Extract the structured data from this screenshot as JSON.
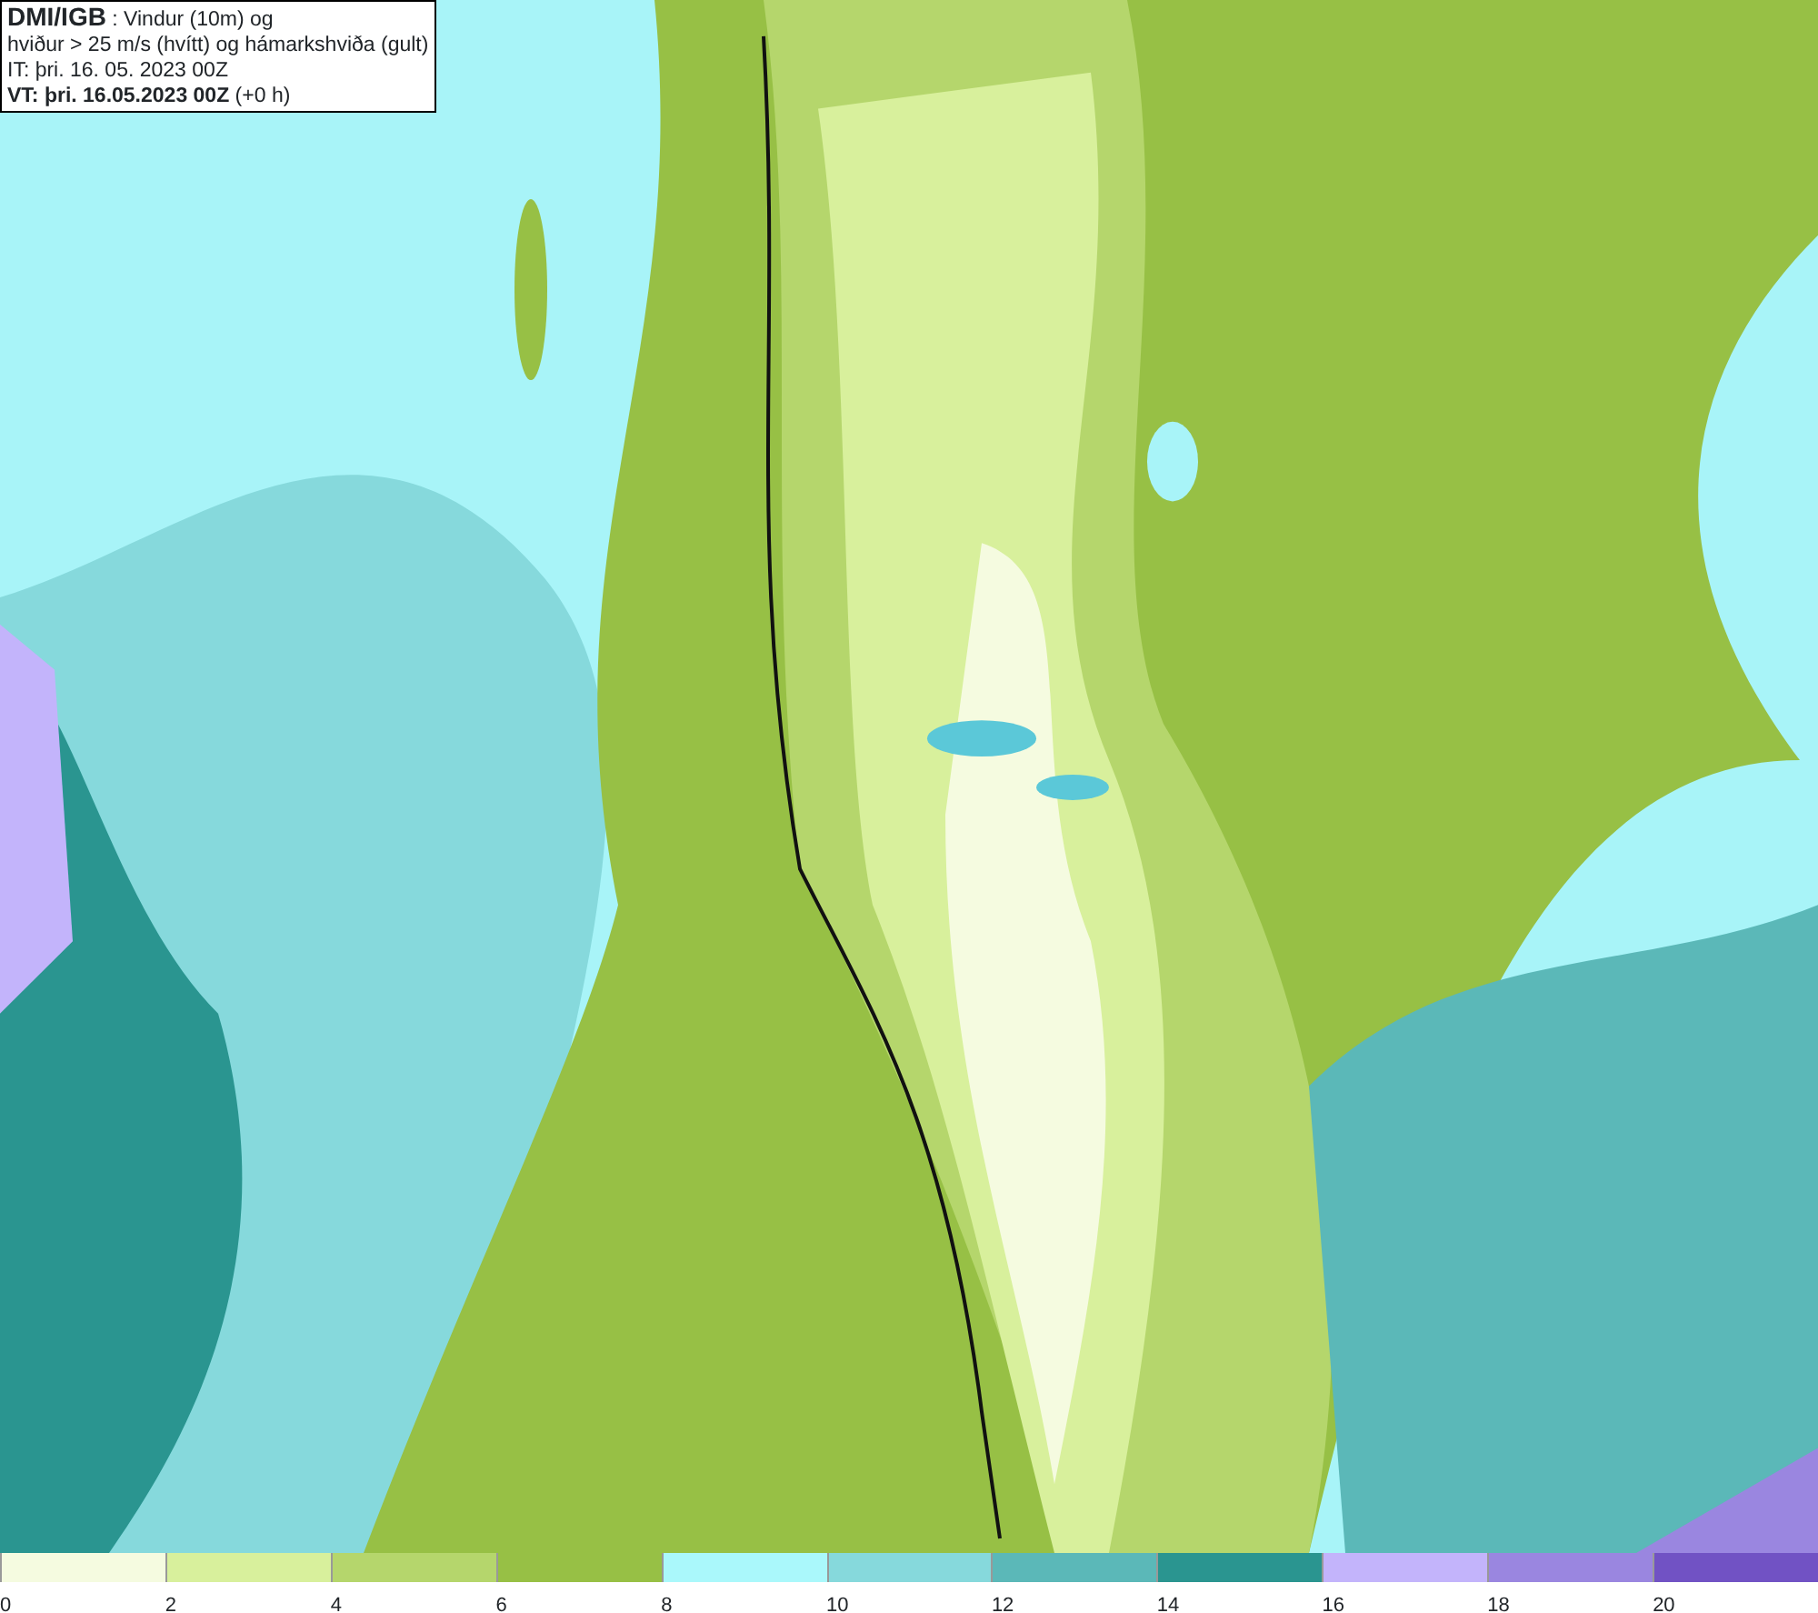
{
  "title_box": {
    "lines": [
      "**DMI/IGB** : Vindur (10m) og",
      "hviður > 25 m/s (hvítt) og hámarkshviða (gult)",
      "IT: þri. 16. 05. 2023 00Z",
      "**VT: þri. 16.05.2023 00Z** (+0 h)"
    ]
  },
  "legend": [
    {
      "label": "0",
      "color": "#f5fbe0"
    },
    {
      "label": "2",
      "color": "#d8f09c"
    },
    {
      "label": "4",
      "color": "#b5d66c"
    },
    {
      "label": "6",
      "color": "#97c045"
    },
    {
      "label": "8",
      "color": "#aaf8fb"
    },
    {
      "label": "10",
      "color": "#86d9dc"
    },
    {
      "label": "12",
      "color": "#5bb8b8"
    },
    {
      "label": "14",
      "color": "#2a9590"
    },
    {
      "label": "16",
      "color": "#c3b4fb"
    },
    {
      "label": "18",
      "color": "#9a86e0"
    },
    {
      "label": "20",
      "color": "#7152c4"
    }
  ]
}
